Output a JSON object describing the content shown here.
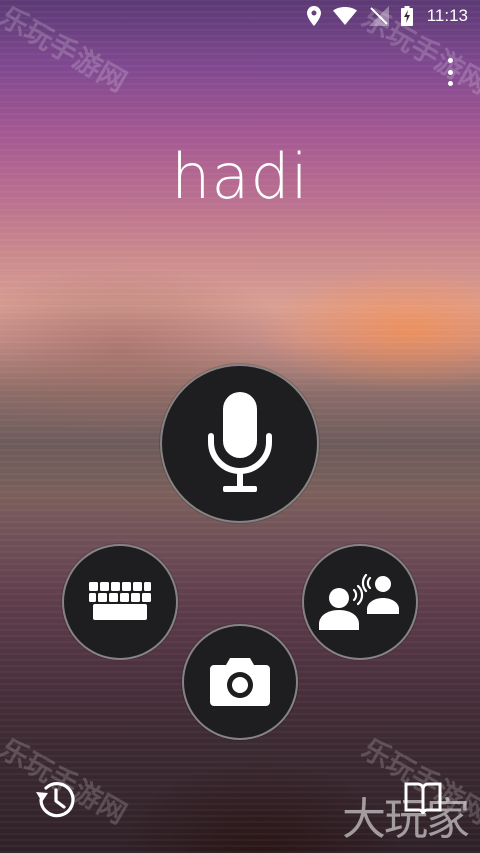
{
  "status_bar": {
    "time": "11:13",
    "icons": [
      "location-icon",
      "wifi-icon",
      "signal-off-icon",
      "battery-charging-icon"
    ]
  },
  "header": {
    "menu_icon": "overflow-menu-icon",
    "title": "hadi"
  },
  "actions": {
    "microphone": "microphone-icon",
    "keyboard": "keyboard-icon",
    "conversation": "conversation-icon",
    "camera": "camera-icon"
  },
  "footer": {
    "history": "history-icon",
    "phrasebook": "phrasebook-icon"
  },
  "watermarks": {
    "text": "乐玩手游网",
    "corner": "大玩家"
  },
  "colors": {
    "button_fill": "#1e1d1f",
    "icon": "#ffffff"
  }
}
